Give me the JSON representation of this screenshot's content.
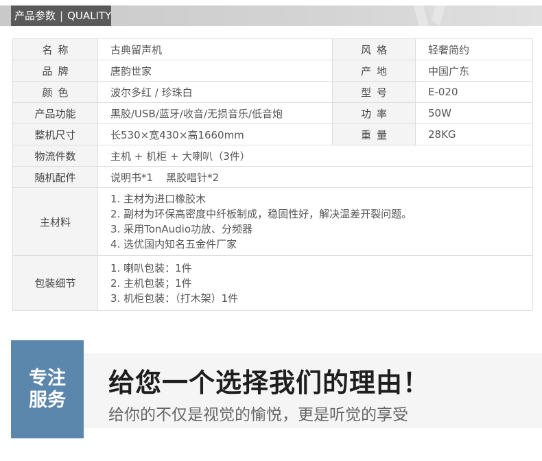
{
  "header": {
    "title_cn": "产品参数",
    "separator": "|",
    "title_en": "QUALITY"
  },
  "specs": {
    "rows2": [
      {
        "k1": "名称",
        "v1": "古典留声机",
        "k2": "风格",
        "v2": "轻奢简约"
      },
      {
        "k1": "品牌",
        "v1": "唐韵世家",
        "k2": "产地",
        "v2": "中国广东"
      },
      {
        "k1": "颜色",
        "v1": "波尔多红 / 珍珠白",
        "k2": "型号",
        "v2": "E-020"
      },
      {
        "k1": "产品功能",
        "v1": "黑胶/USB/蓝牙/收音/无损音乐/低音炮",
        "k2": "功率",
        "v2": "50W"
      },
      {
        "k1": "整机尺寸",
        "v1": "长530×宽430×高1660mm",
        "k2": "重量",
        "v2": "28KG"
      }
    ],
    "logistics": {
      "k": "物流件数",
      "v": "主机 + 机柜 + 大喇叭（3件）"
    },
    "accessories": {
      "k": "随机配件",
      "v": "说明书*1    黑胶唱针*2"
    },
    "materials": {
      "k": "主材料",
      "lines": [
        "1. 主材为进口橡胶木",
        "2. 副材为环保高密度中纤板制成，稳固性好，解决温差开裂问题。",
        "3. 采用TonAudio功放、分频器",
        "4. 选优国内知名五金件厂家"
      ]
    },
    "packaging": {
      "k": "包装细节",
      "lines": [
        "1. 喇叭包装：1件",
        "2. 主机包装；1件",
        "3. 机柜包装：（打木架）1件"
      ]
    }
  },
  "promo": {
    "block_text": "专注服务",
    "title": "给您一个选择我们的理由！",
    "subtitle": "给你的不仅是视觉的愉悦，更是听觉的享受"
  },
  "colors": {
    "header_chip": "#5a5a5a",
    "header_bar": "#d0d0d0",
    "promo_block": "#5b87ad",
    "table_border": "#dedede",
    "key_cell_bg": "#f4f4f4"
  }
}
